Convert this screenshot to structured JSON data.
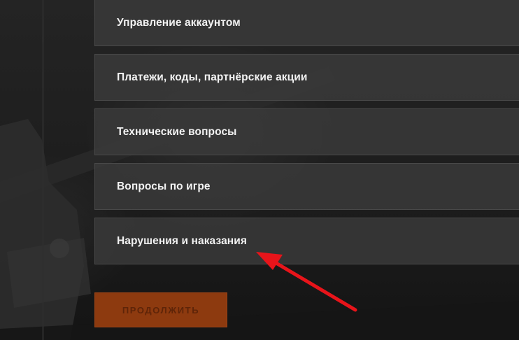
{
  "topics": [
    {
      "label": "Управление аккаунтом"
    },
    {
      "label": "Платежи, коды, партнёрские акции"
    },
    {
      "label": "Технические вопросы"
    },
    {
      "label": "Вопросы по игре"
    },
    {
      "label": "Нарушения и наказания"
    }
  ],
  "continue_label": "ПРОДОЛЖИТЬ",
  "colors": {
    "accent_button": "#8d3a0f",
    "annotation_arrow": "#e8141a",
    "option_bg": "#3a3a3a"
  },
  "icons": {
    "annotation": "red-arrow-icon"
  }
}
